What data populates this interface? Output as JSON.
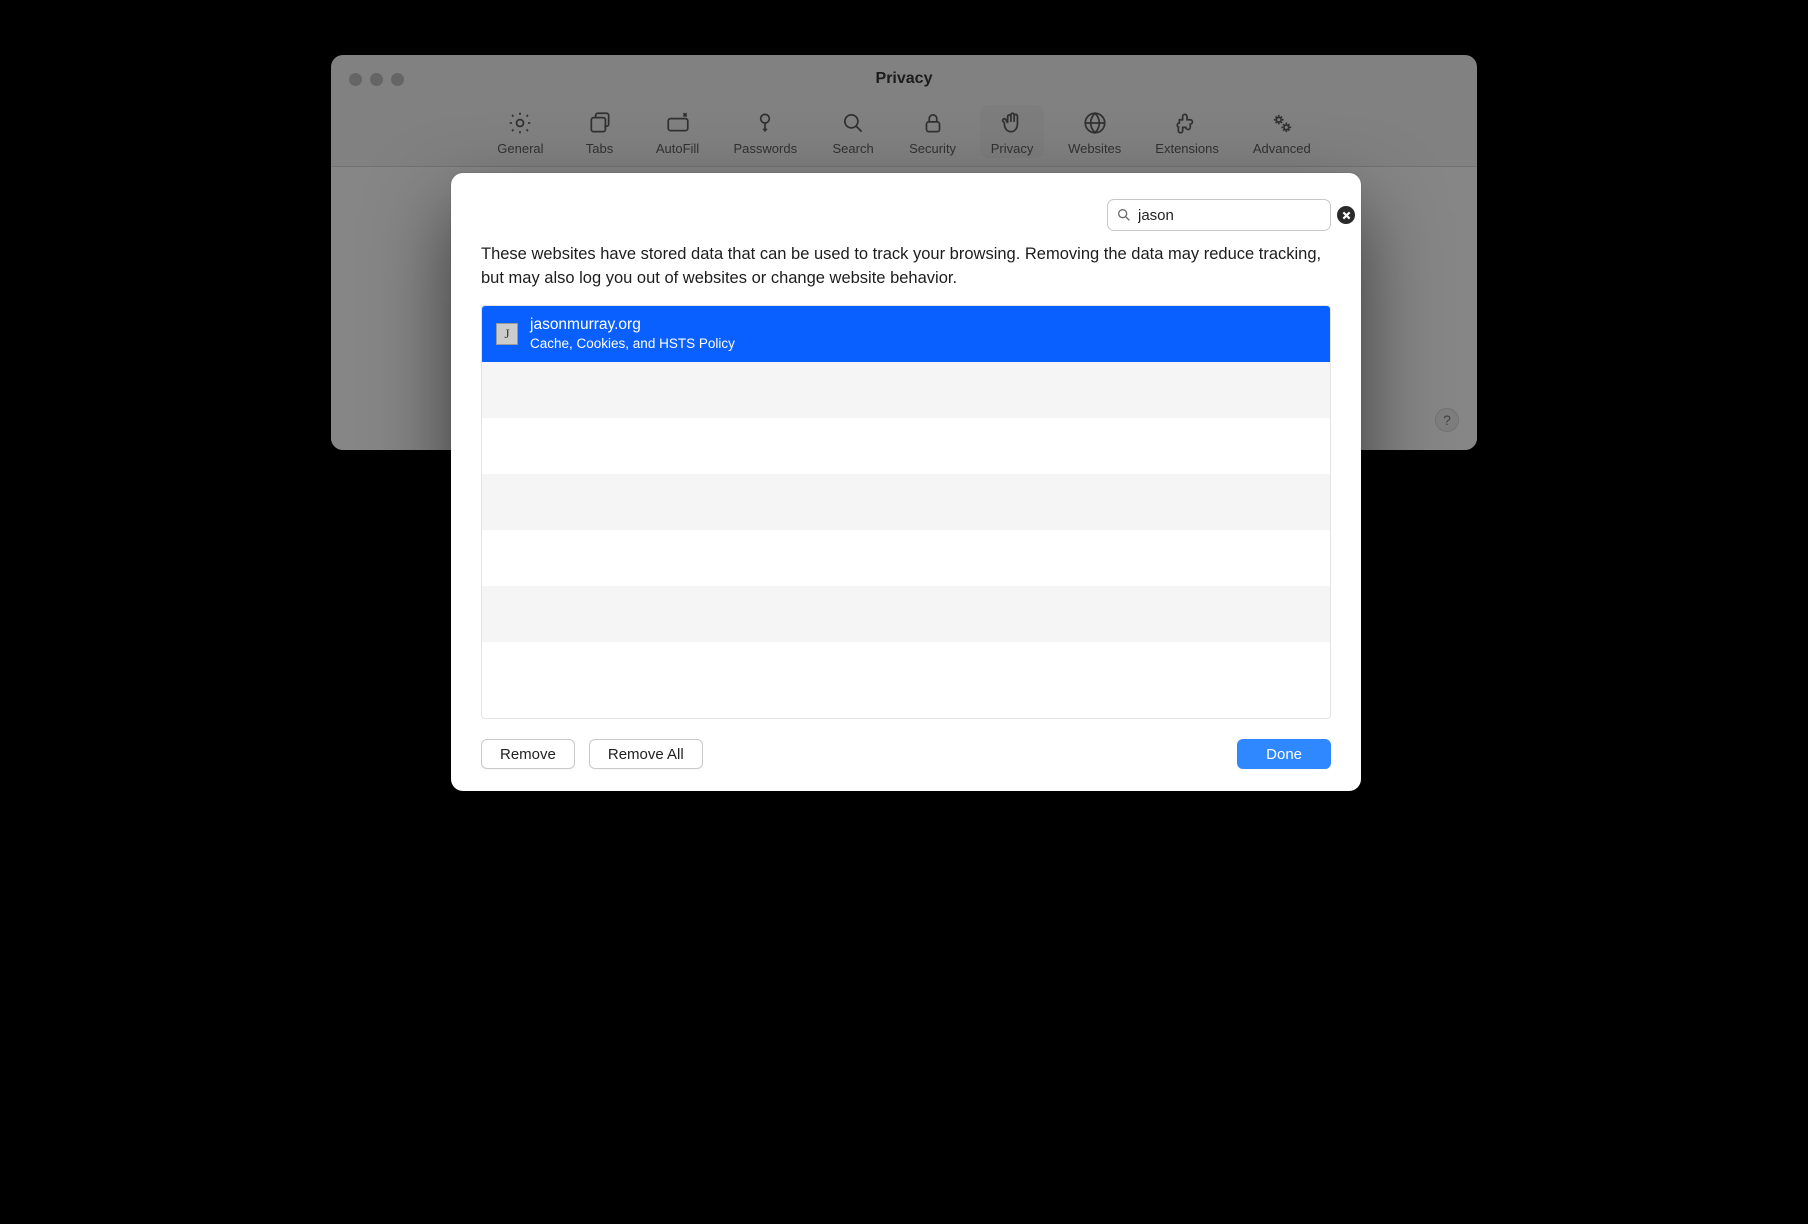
{
  "window": {
    "title": "Privacy"
  },
  "toolbar": {
    "items": [
      {
        "label": "General"
      },
      {
        "label": "Tabs"
      },
      {
        "label": "AutoFill"
      },
      {
        "label": "Passwords"
      },
      {
        "label": "Search"
      },
      {
        "label": "Security"
      },
      {
        "label": "Privacy"
      },
      {
        "label": "Websites"
      },
      {
        "label": "Extensions"
      },
      {
        "label": "Advanced"
      }
    ],
    "selected": "Privacy"
  },
  "sheet": {
    "search_value": "jason",
    "description": "These websites have stored data that can be used to track your browsing. Removing the data may reduce tracking, but may also log you out of websites or change website behavior.",
    "rows": [
      {
        "favicon_letter": "J",
        "title": "jasonmurray.org",
        "subtitle": "Cache, Cookies, and HSTS Policy",
        "selected": true
      }
    ],
    "buttons": {
      "remove": "Remove",
      "remove_all": "Remove All",
      "done": "Done"
    }
  },
  "help_label": "?"
}
